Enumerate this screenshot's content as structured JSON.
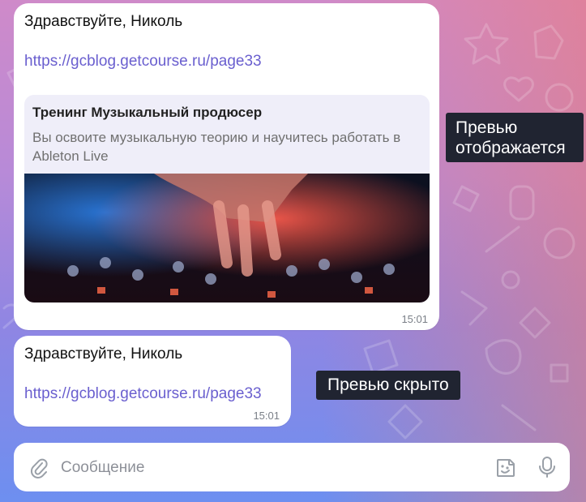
{
  "messages": [
    {
      "greeting": "Здравствуйте, Николь",
      "link": "https://gcblog.getcourse.ru/page33",
      "time": "15:01",
      "preview": {
        "title": "Тренинг Музыкальный продюсер",
        "description": "Вы освоите музыкальную теорию и научитесь работать в Ableton Live"
      }
    },
    {
      "greeting": "Здравствуйте, Николь",
      "link": "https://gcblog.getcourse.ru/page33",
      "time": "15:01"
    }
  ],
  "annotations": {
    "preview_shown": "Превью отображается",
    "preview_hidden": "Превью скрыто"
  },
  "composer": {
    "placeholder": "Сообщение",
    "icons": [
      "paperclip-icon",
      "sticker-icon",
      "microphone-icon"
    ]
  },
  "colors": {
    "link": "#6a5fcf",
    "tooltip_bg": "#202431",
    "bubble": "#ffffff"
  }
}
